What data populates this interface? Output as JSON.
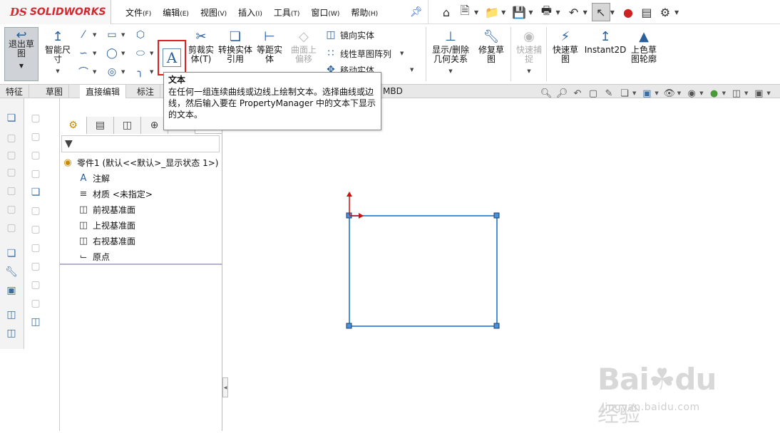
{
  "app": {
    "logo_prefix": "DS",
    "logo_text": "SOLIDWORKS"
  },
  "menu": [
    {
      "label": "文件",
      "key": "(F)"
    },
    {
      "label": "编辑",
      "key": "(E)"
    },
    {
      "label": "视图",
      "key": "(V)"
    },
    {
      "label": "插入",
      "key": "(I)"
    },
    {
      "label": "工具",
      "key": "(T)"
    },
    {
      "label": "窗口",
      "key": "(W)"
    },
    {
      "label": "帮助",
      "key": "(H)"
    }
  ],
  "ribbon": {
    "exit_sketch": "退出草图",
    "smart_dim": "智能尺寸",
    "trim": "剪裁实体(T)",
    "convert": "转换实体引用",
    "offset": "等距实体",
    "surface_offset": "曲面上偏移",
    "mirror": "镜向实体",
    "linear_pattern": "线性草图阵列",
    "move_partial": "移动实体",
    "show_relations": "显示/删除几何关系",
    "repair": "修复草图",
    "quick_snap": "快速捕捉",
    "quick_sketch": "快速草图",
    "instant2d": "Instant2D",
    "shaded": "上色草图轮廓"
  },
  "tabs": [
    "特征",
    "草图",
    "直接编辑",
    "标注",
    "MBD"
  ],
  "tooltip": {
    "title": "文本",
    "body": "在任何一组连续曲线或边线上绘制文本。选择曲线或边线，然后输入要在 PropertyManager 中的文本下显示的文本。"
  },
  "tree": {
    "root": "零件1 (默认<<默认>_显示状态 1>)",
    "items": [
      "注解",
      "材质 <未指定>",
      "前视基准面",
      "上视基准面",
      "右视基准面",
      "原点"
    ]
  },
  "watermark": {
    "logo": "Bai",
    "logo2": "du",
    "cn": "经验",
    "url": "jingyan.baidu.com"
  },
  "colors": {
    "accent": "#d8262f",
    "sketch": "#4a90d9",
    "highlight": "#e02020"
  }
}
